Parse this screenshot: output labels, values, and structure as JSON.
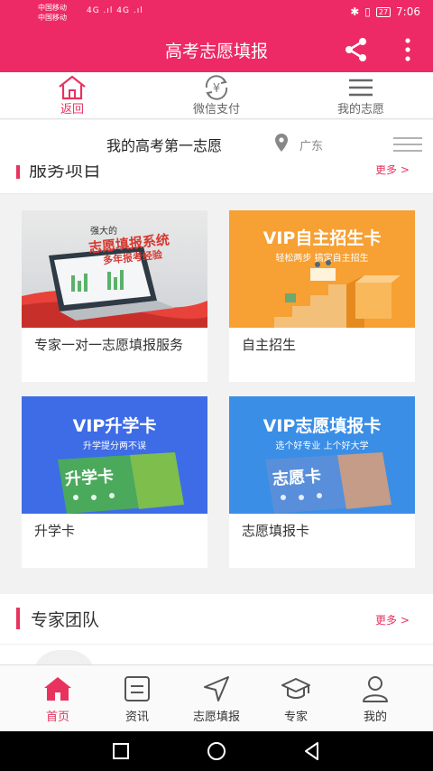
{
  "status_bar": {
    "carrier1": "中国移动",
    "carrier2": "中国移动",
    "signal_text": "4G .ıl 4G .ıl",
    "battery": "27",
    "time": "7:06"
  },
  "app_bar": {
    "title": "高考志愿填报"
  },
  "top_tabs": [
    {
      "label": "返回",
      "icon": "home-icon"
    },
    {
      "label": "微信支付",
      "icon": "yuan-exchange-icon"
    },
    {
      "label": "我的志愿",
      "icon": "menu-icon"
    }
  ],
  "subheader": {
    "title": "我的高考第一志愿",
    "location": "广东"
  },
  "section_services": {
    "title": "服务项目",
    "more": "更多 >"
  },
  "cards": [
    {
      "caption": "专家一对一志愿填报服务",
      "thumb_line1": "强大的",
      "thumb_line2": "志愿填报系统",
      "thumb_line3": "多年报考经验"
    },
    {
      "caption": "自主招生",
      "thumb_title": "VIP自主招生卡",
      "thumb_sub": "轻松两步  搞定自主招生"
    },
    {
      "caption": "升学卡",
      "thumb_title": "VIP升学卡",
      "thumb_sub": "升学提分两不误",
      "card_text": "升学卡"
    },
    {
      "caption": "志愿填报卡",
      "thumb_title": "VIP志愿填报卡",
      "thumb_sub": "选个好专业  上个好大学",
      "card_text": "志愿卡"
    }
  ],
  "section_experts": {
    "title": "专家团队",
    "more": "更多 >"
  },
  "bottom_nav": [
    {
      "label": "首页",
      "icon": "home-filled-icon"
    },
    {
      "label": "资讯",
      "icon": "news-icon"
    },
    {
      "label": "志愿填报",
      "icon": "navigation-arrow-icon"
    },
    {
      "label": "专家",
      "icon": "graduation-cap-icon"
    },
    {
      "label": "我的",
      "icon": "user-icon"
    }
  ],
  "colors": {
    "primary": "#ee2a66",
    "accent": "#e8335f",
    "orange": "#f7a033",
    "green": "#4caf50",
    "blue": "#3a8ee6"
  }
}
